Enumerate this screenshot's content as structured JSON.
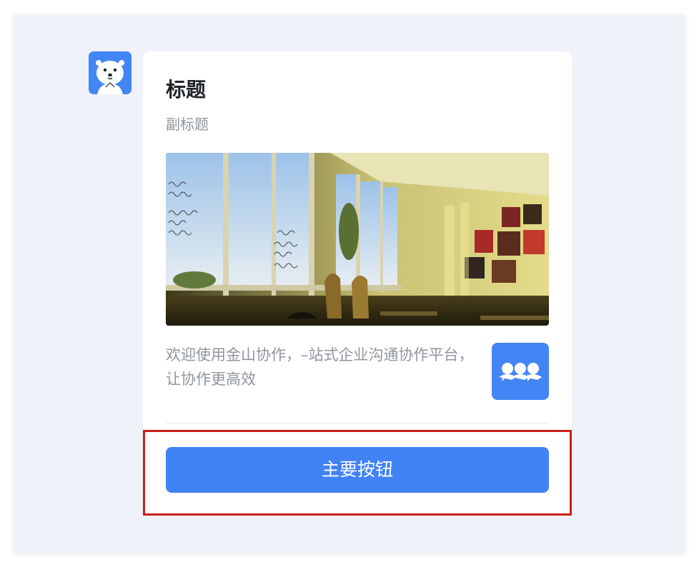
{
  "message": {
    "avatar_icon": "seal-mascot-icon",
    "card": {
      "title": "标题",
      "subtitle": "副标题",
      "image": "classroom-photo",
      "description": "欢迎使用金山协作，–站式企业沟通协作平台，让协作更高效",
      "app_icon": "team-members-icon",
      "primary_button_label": "主要按钮"
    }
  },
  "colors": {
    "page_background": "#eff2f8",
    "card_background": "#ffffff",
    "brand_blue": "#4285f4",
    "button_blue": "#4182f5",
    "highlight_red": "#cc1d1d",
    "title_text": "#1f2329",
    "secondary_text": "#8f959e"
  }
}
